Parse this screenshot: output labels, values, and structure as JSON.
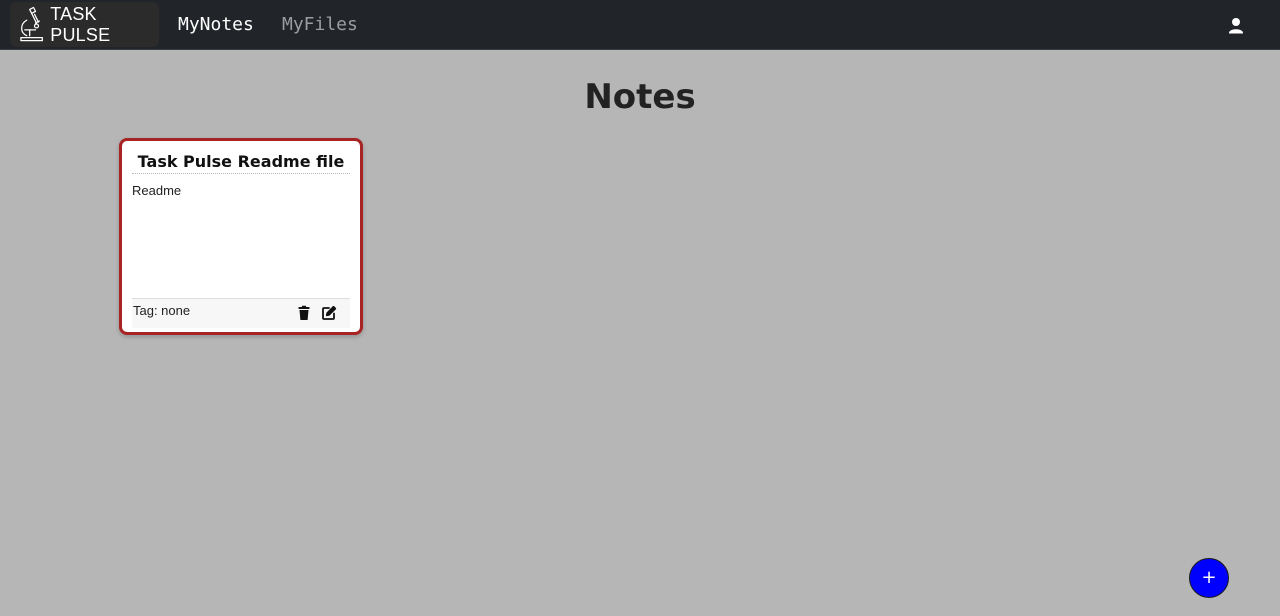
{
  "navbar": {
    "brand": "TASK PULSE",
    "brand_icon": "microscope-icon",
    "links": [
      {
        "label": "MyNotes",
        "active": true
      },
      {
        "label": "MyFiles",
        "active": false
      }
    ],
    "user_icon": "user-icon",
    "background": "#212529"
  },
  "page": {
    "title": "Notes",
    "background": "#b6b6b6"
  },
  "notes": [
    {
      "title": "Task Pulse Readme file",
      "body": "Readme",
      "tag": "Tag: none",
      "border_color": "#a82323",
      "actions": [
        "trash-icon",
        "edit-icon"
      ]
    }
  ],
  "fab": {
    "label": "+",
    "color": "#0000ff"
  }
}
